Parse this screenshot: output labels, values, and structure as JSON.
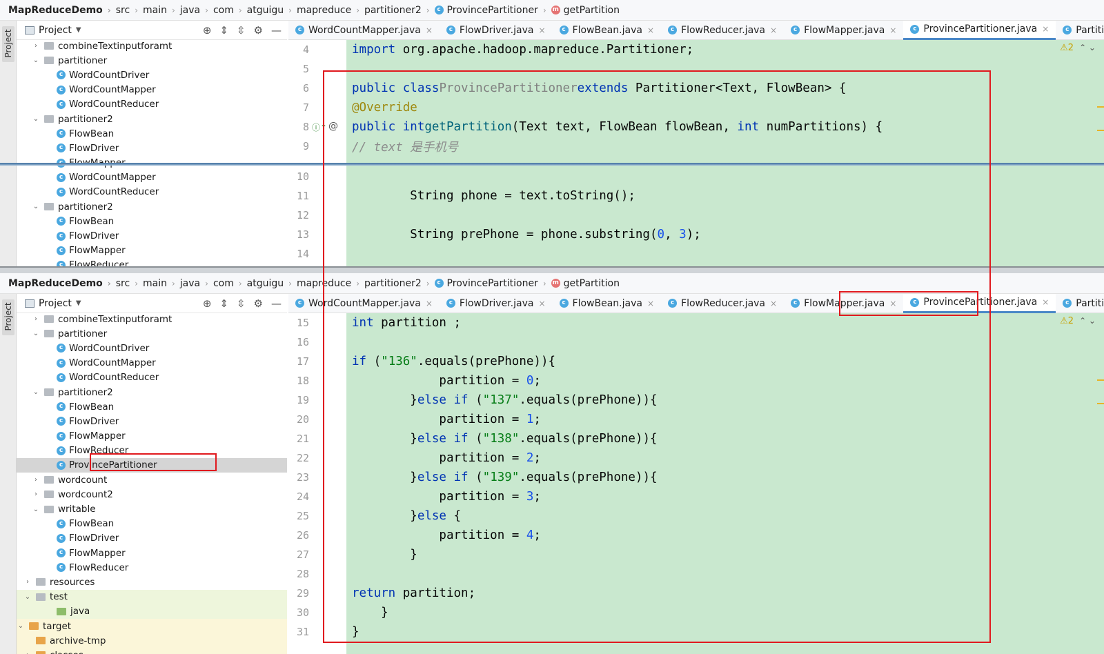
{
  "breadcrumb": {
    "items": [
      "MapReduceDemo",
      "src",
      "main",
      "java",
      "com",
      "atguigu",
      "mapreduce",
      "partitioner2",
      "ProvincePartitioner",
      "getPartition"
    ]
  },
  "project_panel": {
    "title": "Project",
    "stripe_label": "Project"
  },
  "tabs": [
    {
      "label": "WordCountMapper.java",
      "active": false
    },
    {
      "label": "FlowDriver.java",
      "active": false
    },
    {
      "label": "FlowBean.java",
      "active": false
    },
    {
      "label": "FlowReducer.java",
      "active": false
    },
    {
      "label": "FlowMapper.java",
      "active": false
    },
    {
      "label": "ProvincePartitioner.java",
      "active": true
    },
    {
      "label": "Partitioner.java",
      "active": false
    }
  ],
  "warning_count": "2",
  "tree_top": [
    {
      "label": "combineTextinputforamt",
      "type": "folder",
      "arrow": "›"
    },
    {
      "label": "partitioner",
      "type": "folder",
      "arrow": "⌄"
    },
    {
      "label": "WordCountDriver",
      "type": "class"
    },
    {
      "label": "WordCountMapper",
      "type": "class"
    },
    {
      "label": "WordCountReducer",
      "type": "class"
    },
    {
      "label": "partitioner2",
      "type": "folder",
      "arrow": "⌄"
    },
    {
      "label": "FlowBean",
      "type": "class"
    },
    {
      "label": "FlowDriver",
      "type": "class"
    },
    {
      "label": "FlowMapper",
      "type": "class"
    },
    {
      "label": "WordCountMapper",
      "type": "class"
    },
    {
      "label": "WordCountReducer",
      "type": "class"
    },
    {
      "label": "partitioner2",
      "type": "folder",
      "arrow": "⌄"
    },
    {
      "label": "FlowBean",
      "type": "class"
    },
    {
      "label": "FlowDriver",
      "type": "class"
    },
    {
      "label": "FlowMapper",
      "type": "class"
    },
    {
      "label": "FlowReducer",
      "type": "class"
    }
  ],
  "tree_bottom": [
    {
      "label": "combineTextinputforamt",
      "type": "folder",
      "arrow": "›"
    },
    {
      "label": "partitioner",
      "type": "folder",
      "arrow": "⌄"
    },
    {
      "label": "WordCountDriver",
      "type": "class"
    },
    {
      "label": "WordCountMapper",
      "type": "class"
    },
    {
      "label": "WordCountReducer",
      "type": "class"
    },
    {
      "label": "partitioner2",
      "type": "folder",
      "arrow": "⌄"
    },
    {
      "label": "FlowBean",
      "type": "class"
    },
    {
      "label": "FlowDriver",
      "type": "class"
    },
    {
      "label": "FlowMapper",
      "type": "class"
    },
    {
      "label": "FlowReducer",
      "type": "class"
    },
    {
      "label": "ProvincePartitioner",
      "type": "class",
      "selected": true
    },
    {
      "label": "wordcount",
      "type": "folder",
      "arrow": "›"
    },
    {
      "label": "wordcount2",
      "type": "folder",
      "arrow": "›"
    },
    {
      "label": "writable",
      "type": "folder",
      "arrow": "⌄"
    },
    {
      "label": "FlowBean",
      "type": "class"
    },
    {
      "label": "FlowDriver",
      "type": "class"
    },
    {
      "label": "FlowMapper",
      "type": "class"
    },
    {
      "label": "FlowReducer",
      "type": "class"
    },
    {
      "label": "resources",
      "type": "folder",
      "arrow": "›"
    },
    {
      "label": "test",
      "type": "folder",
      "arrow": "⌄"
    },
    {
      "label": "java",
      "type": "folder-green"
    },
    {
      "label": "target",
      "type": "folder-orange",
      "arrow": "⌄"
    },
    {
      "label": "archive-tmp",
      "type": "folder-orange"
    },
    {
      "label": "classes",
      "type": "folder-orange",
      "arrow": "›"
    }
  ],
  "code_top": [
    {
      "n": "4",
      "html": "<span class='kw'>import</span> org.apache.hadoop.mapreduce.Partitioner;"
    },
    {
      "n": "5",
      "html": ""
    },
    {
      "n": "6",
      "html": "<span class='kw'>public class</span> <span class='cn'>ProvincePartitioner</span> <span class='kw'>extends</span> Partitioner&lt;Text, FlowBean&gt; {"
    },
    {
      "n": "7",
      "html": "    <span class='an'>@Override</span>"
    },
    {
      "n": "8",
      "html": "    <span class='kw'>public int</span> <span style='color:#00627a'>getPartition</span>(Text text, FlowBean flowBean, <span class='kw'>int</span> numPartitions) {"
    },
    {
      "n": "9",
      "html": "        <span class='cm'>// text 是手机号</span>"
    }
  ],
  "code_mid": [
    {
      "n": "10",
      "html": ""
    },
    {
      "n": "11",
      "html": "        String phone = text.toString();"
    },
    {
      "n": "12",
      "html": ""
    },
    {
      "n": "13",
      "html": "        String prePhone = phone.substring(<span class='num'>0</span>, <span class='num'>3</span>);"
    },
    {
      "n": "14",
      "html": ""
    }
  ],
  "code_bottom": [
    {
      "n": "15",
      "html": "        <span class='kw'>int</span> partition ;"
    },
    {
      "n": "16",
      "html": ""
    },
    {
      "n": "17",
      "html": "        <span class='kw'>if</span> (<span class='st'>\"136\"</span>.equals(prePhone)){"
    },
    {
      "n": "18",
      "html": "            partition = <span class='num'>0</span>;"
    },
    {
      "n": "19",
      "html": "        }<span class='kw'>else if</span> (<span class='st'>\"137\"</span>.equals(prePhone)){"
    },
    {
      "n": "20",
      "html": "            partition = <span class='num'>1</span>;"
    },
    {
      "n": "21",
      "html": "        }<span class='kw'>else if</span> (<span class='st'>\"138\"</span>.equals(prePhone)){"
    },
    {
      "n": "22",
      "html": "            partition = <span class='num'>2</span>;"
    },
    {
      "n": "23",
      "html": "        }<span class='kw'>else if</span> (<span class='st'>\"139\"</span>.equals(prePhone)){"
    },
    {
      "n": "24",
      "html": "            partition = <span class='num'>3</span>;"
    },
    {
      "n": "25",
      "html": "        }<span class='kw'>else</span> {"
    },
    {
      "n": "26",
      "html": "            partition = <span class='num'>4</span>;"
    },
    {
      "n": "27",
      "html": "        }"
    },
    {
      "n": "28",
      "html": ""
    },
    {
      "n": "29",
      "html": "        <span class='kw'>return</span> partition;"
    },
    {
      "n": "30",
      "html": "    }"
    },
    {
      "n": "31",
      "html": "}"
    }
  ],
  "colors": {
    "accent": "#4a88c7",
    "highlight_box": "#e0191e",
    "code_bg": "#c9e8cf"
  }
}
